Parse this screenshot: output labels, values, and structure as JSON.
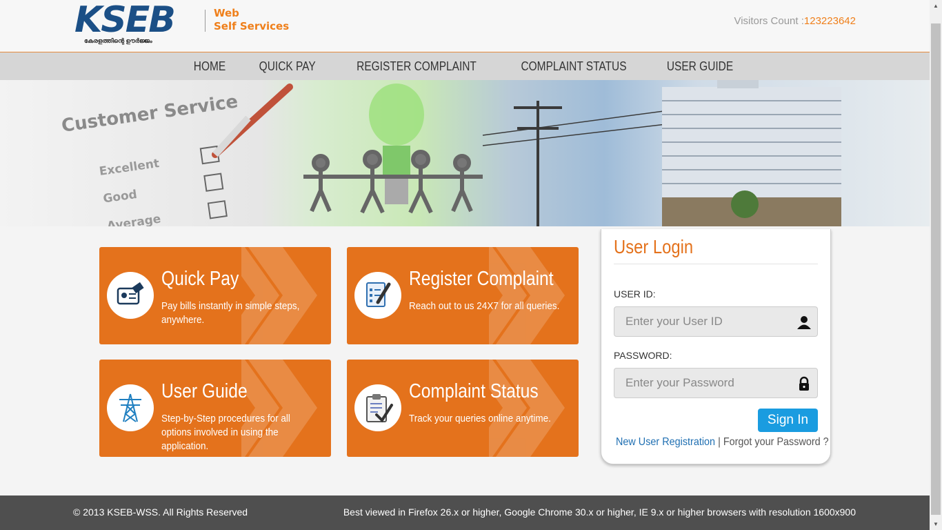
{
  "header": {
    "logo_text": "KSEB",
    "logo_tagline": "കേരളത്തിന്റെ ഊർജ്ജം",
    "site_name_line1": "Web",
    "site_name_line2": "Self Services",
    "visitors_label": "Visitors Count :",
    "visitors_count": "123223642"
  },
  "nav": {
    "items": [
      "HOME",
      "QUICK PAY",
      "REGISTER COMPLAINT",
      "COMPLAINT STATUS",
      "USER GUIDE"
    ]
  },
  "banner": {
    "checklist_heading": "Customer Service",
    "options": [
      "Excellent",
      "Good",
      "Average"
    ]
  },
  "tiles": [
    {
      "title": "Quick Pay",
      "desc": "Pay bills instantly in simple steps, anywhere.",
      "icon": "card-payment-icon"
    },
    {
      "title": "Register Complaint",
      "desc": "Reach out to us 24X7 for all queries.",
      "icon": "form-pen-icon"
    },
    {
      "title": "User Guide",
      "desc": "Step-by-Step procedures for all options involved in using the application.",
      "icon": "transmission-tower-icon"
    },
    {
      "title": "Complaint Status",
      "desc": "Track your queries online anytime.",
      "icon": "clipboard-check-icon"
    }
  ],
  "login": {
    "title": "User Login",
    "user_id_label": "USER ID:",
    "user_id_placeholder": "Enter your User ID",
    "password_label": "PASSWORD:",
    "password_placeholder": "Enter your Password",
    "signin_label": "Sign In",
    "new_user_link": "New User Registration",
    "separator": "|",
    "forgot_link": "Forgot your Password ?"
  },
  "footer": {
    "copyright": "© 2013 KSEB-WSS. All Rights Reserved",
    "browser_note": "Best viewed in Firefox 26.x or higher, Google Chrome 30.x or higher, IE 9.x or higher browsers with resolution 1600x900"
  },
  "colors": {
    "accent": "#e4721c",
    "brand_blue": "#1b4f86",
    "signin": "#1a9ce0",
    "footer": "#4f4f4f"
  }
}
